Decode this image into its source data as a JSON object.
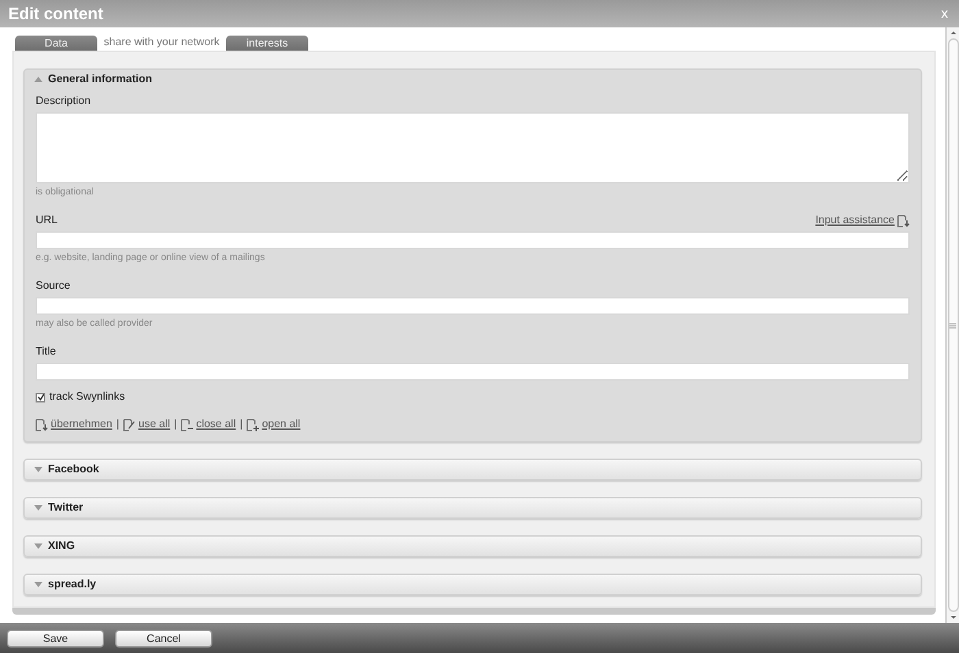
{
  "window": {
    "title": "Edit content",
    "close": "x"
  },
  "tabs": [
    {
      "label": "Data",
      "selected": false
    },
    {
      "label": "share with your network",
      "selected": true
    },
    {
      "label": "interests",
      "selected": false
    }
  ],
  "sections": [
    {
      "title": "General information",
      "expanded": true
    },
    {
      "title": "Facebook",
      "expanded": false
    },
    {
      "title": "Twitter",
      "expanded": false
    },
    {
      "title": "XING",
      "expanded": false
    },
    {
      "title": "spread.ly",
      "expanded": false
    }
  ],
  "form": {
    "fields": [
      {
        "kind": "textarea",
        "label": "Description",
        "hint": "is obligational"
      },
      {
        "kind": "input",
        "label": "URL",
        "link": "Input assistance",
        "hint": "e.g. website, landing page or online view of a mailings"
      },
      {
        "kind": "input",
        "label": "Source",
        "hint": "may also be called provider"
      },
      {
        "kind": "input",
        "label": "Title"
      }
    ],
    "checkbox": {
      "label": "track Swynlinks",
      "checked": true
    },
    "links": [
      {
        "kind": "import",
        "label": "übernehmen"
      },
      {
        "kind": "edit",
        "separator": "|",
        "label": "use all"
      },
      {
        "kind": "collapse",
        "separator": "|",
        "label": "close all"
      },
      {
        "kind": "expand",
        "separator": "|",
        "label": "open all"
      }
    ]
  },
  "buttons": [
    "Save",
    "Cancel"
  ]
}
